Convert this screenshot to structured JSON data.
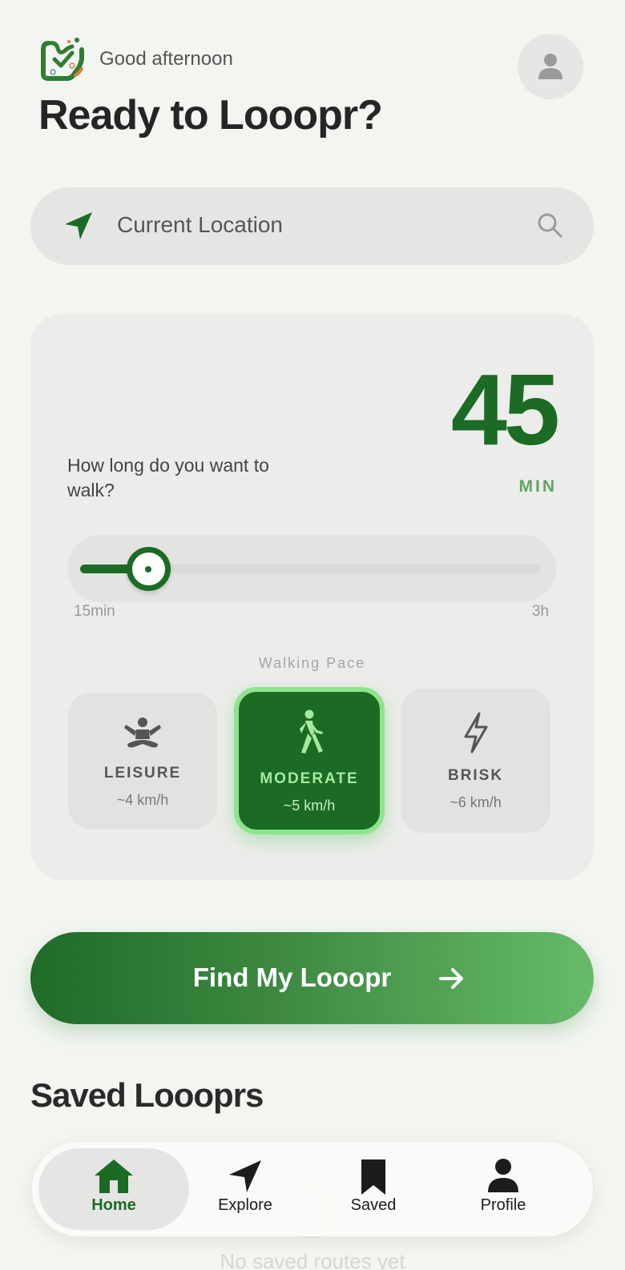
{
  "header": {
    "greeting": "Good afternoon",
    "title": "Ready to Looopr?",
    "logo_icon": "looopr-logo",
    "avatar_icon": "person-icon"
  },
  "search": {
    "location_label": "Current Location",
    "location_icon": "navigation-arrow-icon",
    "search_icon": "search-icon"
  },
  "duration": {
    "question": "How long do you want to walk?",
    "value": "45",
    "unit": "MIN",
    "slider_min_label": "15min",
    "slider_max_label": "3h",
    "slider_value_minutes": 45,
    "slider_min_minutes": 15,
    "slider_max_minutes": 180
  },
  "pace": {
    "title": "Walking Pace",
    "options": [
      {
        "name": "LEISURE",
        "speed": "~4 km/h",
        "icon": "meditation-icon",
        "selected": false
      },
      {
        "name": "MODERATE",
        "speed": "~5 km/h",
        "icon": "walking-icon",
        "selected": true
      },
      {
        "name": "BRISK",
        "speed": "~6 km/h",
        "icon": "lightning-icon",
        "selected": false
      }
    ]
  },
  "cta": {
    "label": "Find My Looopr",
    "icon": "arrow-right-icon"
  },
  "saved": {
    "title": "Saved Looopr s",
    "empty_text": "No saved routes yet"
  },
  "tabs": [
    {
      "label": "Home",
      "icon": "home-icon",
      "active": true
    },
    {
      "label": "Explore",
      "icon": "navigation-arrow-icon",
      "active": false
    },
    {
      "label": "Saved",
      "icon": "bookmark-icon",
      "active": false
    },
    {
      "label": "Profile",
      "icon": "person-icon",
      "active": false
    }
  ],
  "colors": {
    "brand_green": "#1b6b25",
    "accent_light_green": "#66bb6a",
    "background": "#f3f5f1"
  }
}
